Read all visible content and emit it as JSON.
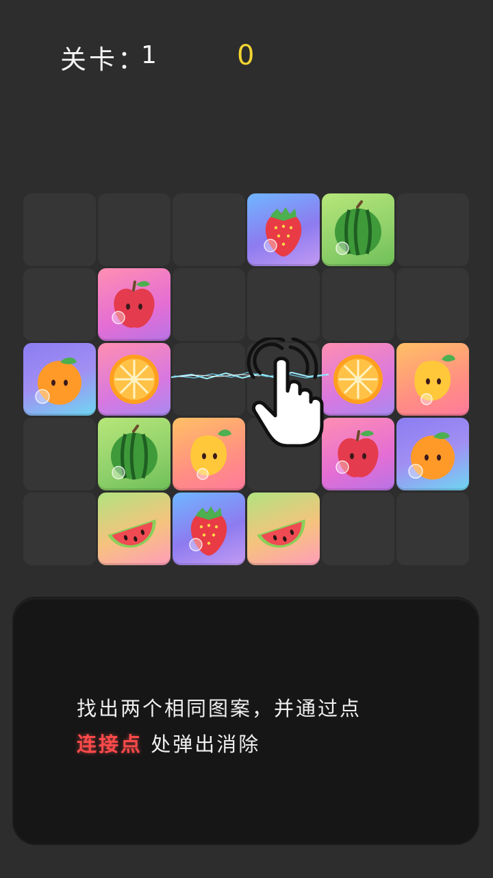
{
  "hud": {
    "level_label": "关卡：",
    "level_value": "1",
    "score": "0"
  },
  "board": {
    "rows": 5,
    "cols": 6,
    "cells": [
      [
        null,
        null,
        null,
        "strawberry",
        "watermelon",
        null
      ],
      [
        null,
        "apple",
        null,
        null,
        null,
        null
      ],
      [
        "orange",
        "orange-slice",
        null,
        null,
        "orange-slice",
        "mango"
      ],
      [
        null,
        "watermelon",
        "mango",
        null,
        "apple",
        "orange"
      ],
      [
        null,
        "watermelon-slice",
        "strawberry",
        "watermelon-slice",
        null,
        null
      ]
    ]
  },
  "overlay": {
    "hand_icon": "tap-hand-icon",
    "link_effect": "lightning-link"
  },
  "tip": {
    "line1": "找出两个相同图案，并通过点",
    "highlight": "连接点",
    "line2_rest": "处弹出消除"
  },
  "colors": {
    "background": "#2d2d2d",
    "score": "#f2d432",
    "highlight": "#ff4a4a",
    "empty_cell": "#363636"
  }
}
